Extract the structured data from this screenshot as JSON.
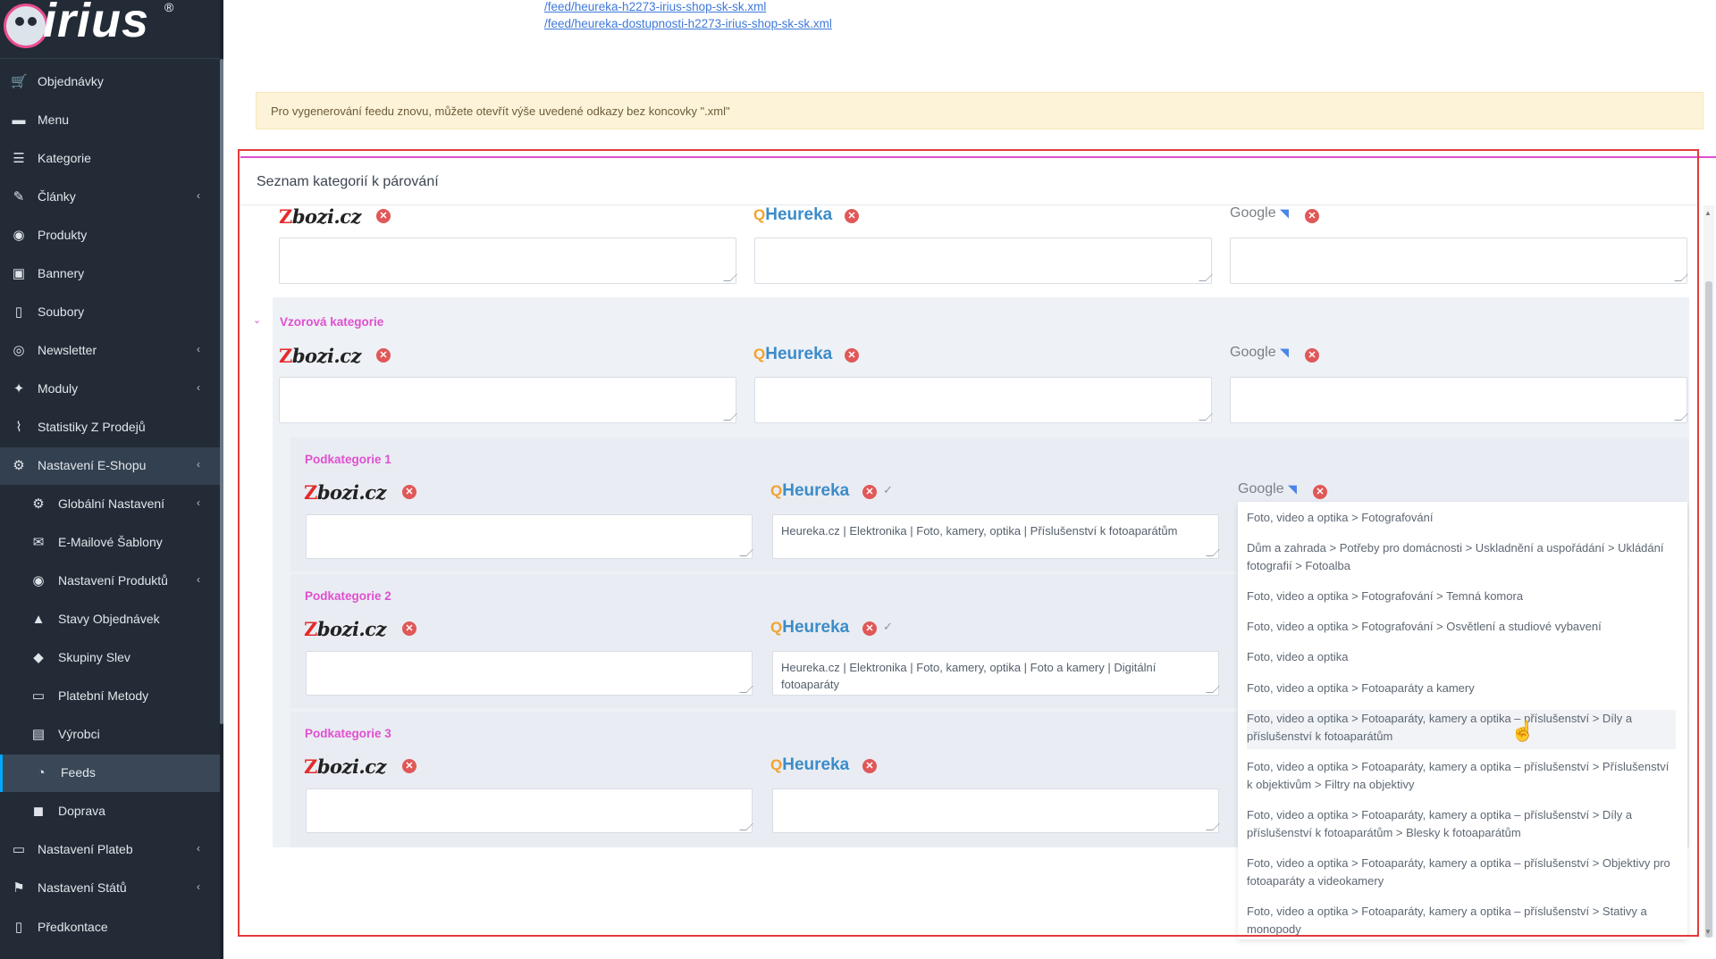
{
  "app": {
    "logo_text": "irius",
    "logo_mark": "®"
  },
  "sidebar": {
    "items": [
      {
        "label": "Objednávky",
        "icon": "cart-icon",
        "glyph": "🛒",
        "chevron": false
      },
      {
        "label": "Menu",
        "icon": "folder-icon",
        "glyph": "▬",
        "chevron": false
      },
      {
        "label": "Kategorie",
        "icon": "list-icon",
        "glyph": "☰",
        "chevron": false
      },
      {
        "label": "Články",
        "icon": "pencil-icon",
        "glyph": "✎",
        "chevron": true
      },
      {
        "label": "Produkty",
        "icon": "palette-icon",
        "glyph": "◉",
        "chevron": false
      },
      {
        "label": "Bannery",
        "icon": "image-icon",
        "glyph": "▣",
        "chevron": false
      },
      {
        "label": "Soubory",
        "icon": "file-icon",
        "glyph": "▯",
        "chevron": false
      },
      {
        "label": "Newsletter",
        "icon": "newsletter-icon",
        "glyph": "◎",
        "chevron": true
      },
      {
        "label": "Moduly",
        "icon": "puzzle-icon",
        "glyph": "✦",
        "chevron": true
      },
      {
        "label": "Statistiky Z Prodejů",
        "icon": "chart-line-icon",
        "glyph": "⌇",
        "chevron": false
      },
      {
        "label": "Nastavení E-Shopu",
        "icon": "settings-icon",
        "glyph": "⚙",
        "chevron": true
      },
      {
        "label": "Globální Nastavení",
        "icon": "gear-icon",
        "glyph": "⚙",
        "chevron": true
      },
      {
        "label": "E-Mailové Šablony",
        "icon": "envelope-icon",
        "glyph": "✉",
        "chevron": false
      },
      {
        "label": "Nastavení Produktů",
        "icon": "palette-icon",
        "glyph": "◉",
        "chevron": true
      },
      {
        "label": "Stavy Objednávek",
        "icon": "bell-icon",
        "glyph": "▲",
        "chevron": false
      },
      {
        "label": "Skupiny Slev",
        "icon": "tag-icon",
        "glyph": "◆",
        "chevron": false
      },
      {
        "label": "Platební Metody",
        "icon": "credit-card-icon",
        "glyph": "▭",
        "chevron": false
      },
      {
        "label": "Výrobci",
        "icon": "building-icon",
        "glyph": "▤",
        "chevron": false
      },
      {
        "label": "Feeds",
        "icon": "rss-icon",
        "glyph": "◔",
        "chevron": false
      },
      {
        "label": "Doprava",
        "icon": "truck-icon",
        "glyph": "◼",
        "chevron": false
      },
      {
        "label": "Nastavení Plateb",
        "icon": "credit-card-icon",
        "glyph": "▭",
        "chevron": true
      },
      {
        "label": "Nastavení Států",
        "icon": "flag-icon",
        "glyph": "⚑",
        "chevron": true
      },
      {
        "label": "Předkontace",
        "icon": "file-icon",
        "glyph": "▯",
        "chevron": false
      }
    ],
    "chevron_glyph": "‹"
  },
  "feed_links": [
    "/feed/heureka-h2273-irius-shop-sk-sk.xml",
    "/feed/heureka-dostupnosti-h2273-irius-shop-sk-sk.xml"
  ],
  "alert": "Pro vygenerování feedu znovu, můžete otevřít výše uvedené odkazy bez koncovky \".xml\"",
  "section": {
    "title": "Seznam kategorií k párování"
  },
  "logos": {
    "zbozi": "bozi.cz",
    "zbozi_z": "Z",
    "heureka": "Heureka",
    "heureka_icon": "Q",
    "google": "Google",
    "google_tag": "◥",
    "remove_glyph": "✕",
    "check_glyph": "✓",
    "caret_glyph": "⌄"
  },
  "categories": {
    "main": {
      "label": "Vzorová kategorie"
    },
    "sub1": {
      "label": "Podkategorie 1",
      "heureka_value": "Heureka.cz | Elektronika | Foto, kamery, optika | Příslušenství k fotoaparátům"
    },
    "sub2": {
      "label": "Podkategorie 2",
      "heureka_value": "Heureka.cz | Elektronika | Foto, kamery, optika | Foto a kamery | Digitální fotoaparáty"
    },
    "sub3": {
      "label": "Podkategorie 3"
    }
  },
  "google_dropdown": [
    "Foto, video a optika > Fotografování",
    "Dům a zahrada > Potřeby pro domácnosti > Uskladnění a uspořádání > Ukládání fotografií > Fotoalba",
    "Foto, video a optika > Fotografování > Temná komora",
    "Foto, video a optika > Fotografování > Osvětlení a studiové vybavení",
    "Foto, video a optika",
    "Foto, video a optika > Fotoaparáty a kamery",
    "Foto, video a optika > Fotoaparáty, kamery a optika – příslušenství > Díly a příslušenství k fotoaparátům",
    "Foto, video a optika > Fotoaparáty, kamery a optika – příslušenství > Příslušenství k objektivům > Filtry na objektivy",
    "Foto, video a optika > Fotoaparáty, kamery a optika – příslušenství > Díly a příslušenství k fotoaparátům > Blesky k fotoaparátům",
    "Foto, video a optika > Fotoaparáty, kamery a optika – příslušenství > Objektivy pro fotoaparáty a videokamery",
    "Foto, video a optika > Fotoaparáty, kamery a optika – příslušenství > Stativy a monopody"
  ],
  "colors": {
    "sidebar_bg": "#222b36",
    "accent_pink": "#e04fcf",
    "remove_red": "#e05858",
    "alert_bg": "#fdf3d8",
    "highlight_border": "#e33b3b"
  }
}
